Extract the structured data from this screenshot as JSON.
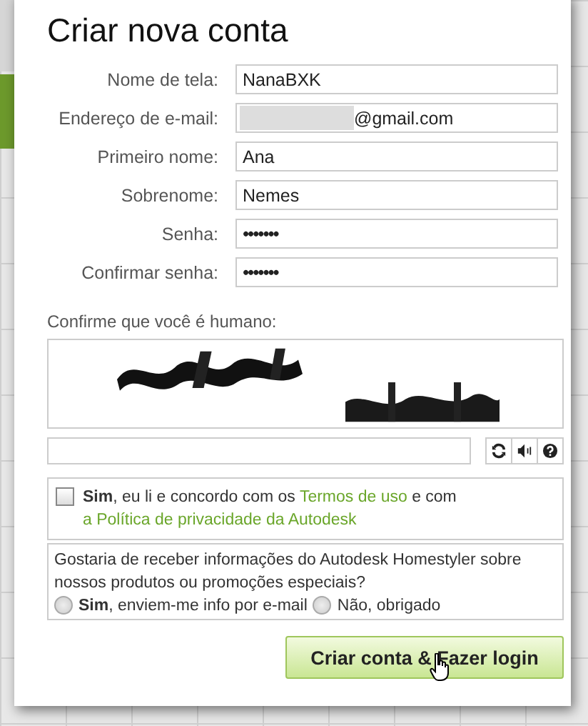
{
  "dialog": {
    "title": "Criar nova conta"
  },
  "fields": [
    {
      "label": "Nome de tela:",
      "value": "NanaBXK",
      "kind": "text"
    },
    {
      "label": "Endereço de e-mail:",
      "value": "@gmail.com",
      "kind": "redacted"
    },
    {
      "label": "Primeiro nome:",
      "value": "Ana",
      "kind": "text"
    },
    {
      "label": "Sobrenome:",
      "value": "Nemes",
      "kind": "text"
    },
    {
      "label": "Senha:",
      "value": "•••••••",
      "kind": "password"
    },
    {
      "label": "Confirmar senha:",
      "value": "•••••••",
      "kind": "password"
    }
  ],
  "captcha": {
    "label": "Confirme que você é humano:"
  },
  "terms": {
    "checked": false,
    "text": "**Sim**, eu li e concordo com os",
    "link_1": "Termos de uso",
    "middle": "e com",
    "link_2": "a Política de privacidade da Autodesk"
  },
  "newsletter": {
    "question": "Gostaria de receber informações do Autodesk Homestyler sobre nossos produtos ou promoções especiais?",
    "options": [
      {
        "label": "**Sim**, enviem-me info por e-mail",
        "selected": false
      },
      {
        "label": "Não, obrigado",
        "selected": false
      }
    ]
  },
  "submit": "Criar conta & Fazer login"
}
